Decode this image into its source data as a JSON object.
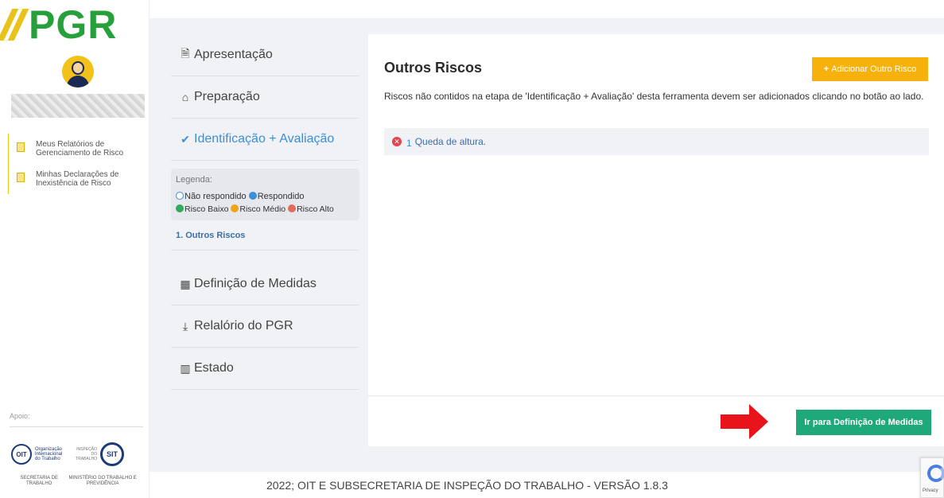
{
  "brand": {
    "logo_text": "PGR"
  },
  "sidebar": {
    "items": [
      {
        "label": "Meus Relatórios de Gerenciamento de Risco"
      },
      {
        "label": "Minhas Declarações de Inexistência de Risco"
      }
    ],
    "apoio_label": "Apoio:",
    "oit_label": "Organização Internacional do Trabalho",
    "oit_abbr": "OIT",
    "inspecao_label": "INSPEÇÃO DO TRABALHO",
    "sit_abbr": "SIT",
    "gov_left": "SECRETARIA DE TRABALHO",
    "gov_right": "MINISTÉRIO DO TRABALHO E PREVIDÊNCIA"
  },
  "steps": {
    "apresentacao": "Apresentação",
    "preparacao": "Preparação",
    "identificacao": "Identificação + Avaliação",
    "definicao": "Definição de Medidas",
    "relatorio": "Relalório do PGR",
    "estado": "Estado"
  },
  "legend": {
    "title": "Legenda:",
    "nao_respondido": "Não respondido",
    "respondido": "Respondido",
    "risco_baixo": "Risco Baixo",
    "risco_medio": "Risco Médio",
    "risco_alto": "Risco Alto"
  },
  "sub_step": "1. Outros Riscos",
  "panel": {
    "title": "Outros Riscos",
    "add_button": "Adicionar Outro Risco",
    "description": "Riscos não contidos na etapa de 'Identificação + Avaliação' desta ferramenta devem ser adicionados clicando no botão ao lado.",
    "risks": [
      {
        "number": "1",
        "label": "Queda de altura."
      }
    ],
    "goto_button": "Ir para Definição de Medidas"
  },
  "footer": {
    "text": "2022; OIT E SUBSECRETARIA DE INSPEÇÃO DO TRABALHO - VERSÃO 1.8.3"
  },
  "recaptcha": {
    "label": "Privacy"
  },
  "colors": {
    "brand_green": "#27a03b",
    "accent_blue": "#3b8fd9",
    "add_button": "#f7b10d",
    "goto_button": "#1fa97a",
    "arrow": "#e8131b"
  }
}
